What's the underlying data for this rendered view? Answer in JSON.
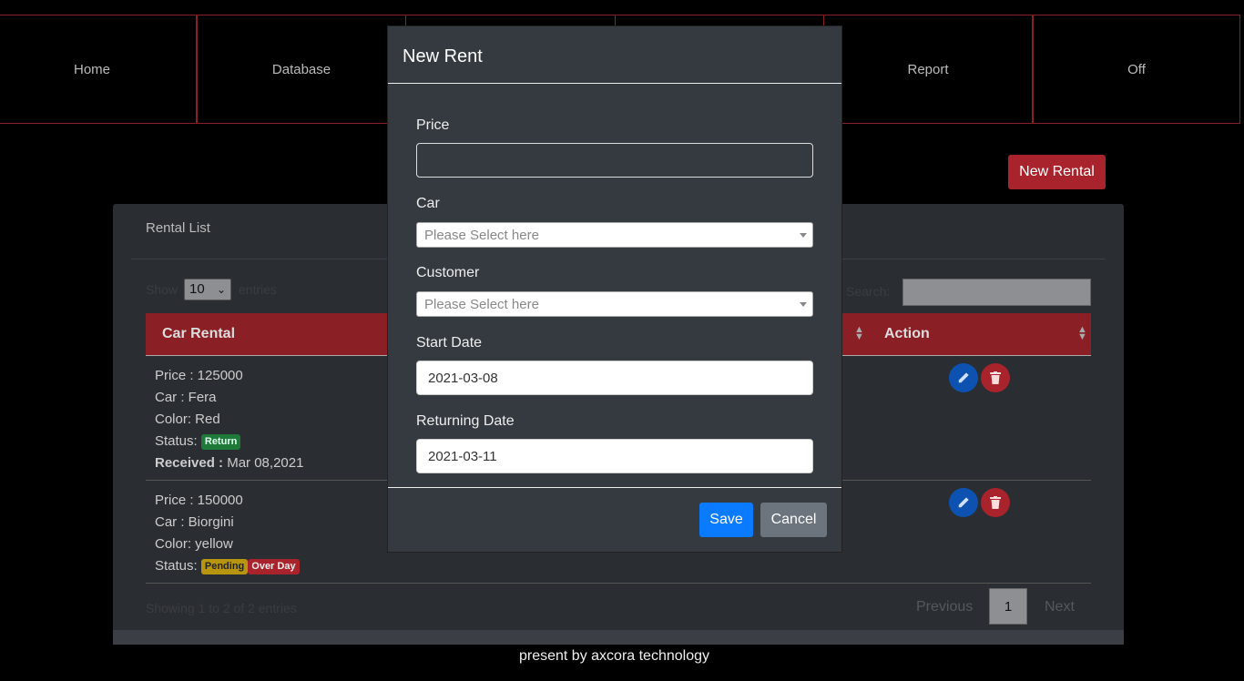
{
  "nav": {
    "items": [
      {
        "label": "Home"
      },
      {
        "label": "Database"
      },
      {
        "label": ""
      },
      {
        "label": ""
      },
      {
        "label": "Report"
      },
      {
        "label": "Off"
      }
    ]
  },
  "toolbar": {
    "new_rental_label": "New Rental"
  },
  "card": {
    "title": "Rental List",
    "show_label": "Show",
    "entries_value": "10",
    "entries_label": "entries",
    "search_label": "Search:",
    "search_value": ""
  },
  "table": {
    "headers": [
      "Car Rental",
      "Action"
    ],
    "rows": [
      {
        "price": "Price : 125000",
        "car": "Car : Fera",
        "color": "Color: Red",
        "status_label": "Status:",
        "badges": [
          "Return"
        ],
        "received_label": "Received :",
        "received_value": " Mar 08,2021"
      },
      {
        "price": "Price : 150000",
        "car": "Car : Biorgini",
        "color": "Color: yellow",
        "status_label": "Status:",
        "badges": [
          "Pending",
          "Over Day"
        ]
      }
    ]
  },
  "pagination": {
    "info": "Showing 1 to 2 of 2 entries",
    "previous": "Previous",
    "page": "1",
    "next": "Next"
  },
  "footer": {
    "text": "present by axcora technology"
  },
  "modal": {
    "title": "New Rent",
    "price_label": "Price",
    "price_value": "",
    "car_label": "Car",
    "car_placeholder": "Please Select here",
    "customer_label": "Customer",
    "customer_placeholder": "Please Select here",
    "start_label": "Start Date",
    "start_value": "2021-03-08",
    "return_label": "Returning Date",
    "return_value": "2021-03-11",
    "save_label": "Save",
    "cancel_label": "Cancel"
  }
}
